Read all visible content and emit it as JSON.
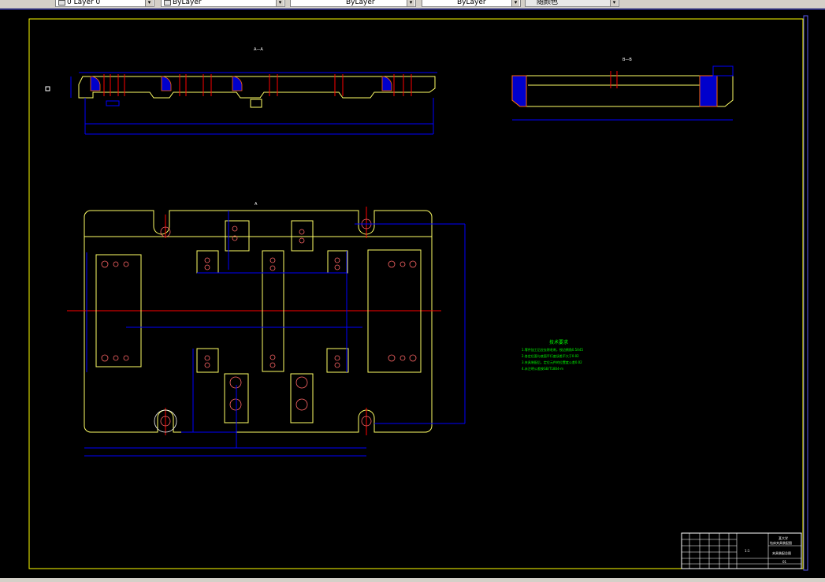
{
  "toolbar": {
    "layer_combo": {
      "value": "0 Layer 0"
    },
    "color_combo": {
      "value": "ByLayer"
    },
    "linetype_combo": {
      "value": "ByLayer"
    },
    "lineweight_combo": {
      "value": "ByLayer"
    },
    "plotstyle_combo": {
      "value": "随颜色"
    }
  },
  "drawing": {
    "front_view_label": "A—A",
    "side_view_label": "B—B",
    "plan_view_label": "A",
    "tech_notes": {
      "title": "技术要求",
      "lines": [
        "1.零件加工后应去除毛刺，锐边倒角0.5X45",
        "2.各定位面与底面平行度误差不大于0.02",
        "3.夹具装配后，定位元件的位置度公差0.02",
        "4.未注明公差按GB/T1804-m"
      ]
    },
    "title_block": {
      "school": "某大学",
      "drawing_name": "钻床夹具装配图",
      "sub_name": "夹具装配总图",
      "scale": "1:1",
      "sheet": "01"
    }
  },
  "colors": {
    "frame": "#ffff00",
    "dimension": "#0000ff",
    "centerline": "#ff0000",
    "notes": "#00ff00",
    "outline": "#ffff66",
    "white": "#ffffff"
  }
}
